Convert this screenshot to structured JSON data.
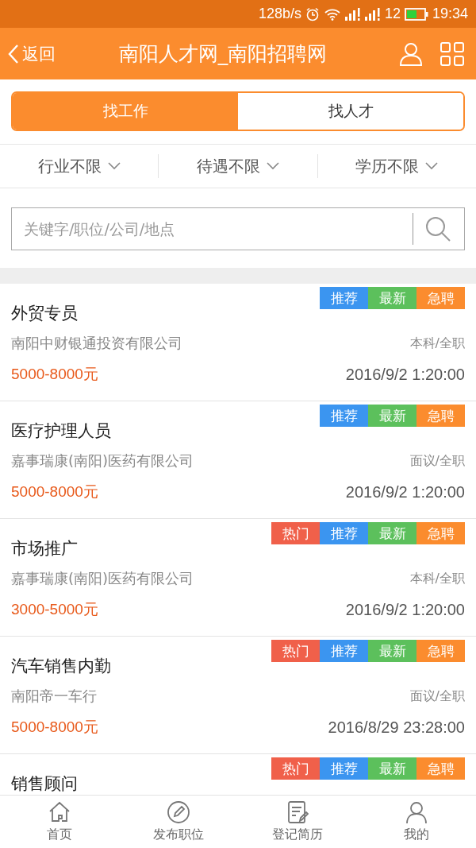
{
  "status_bar": {
    "speed": "128b/s",
    "battery": "12",
    "time": "19:34"
  },
  "header": {
    "back": "返回",
    "title": "南阳人才网_南阳招聘网"
  },
  "tabs": [
    {
      "label": "找工作",
      "selected": true
    },
    {
      "label": "找人才",
      "selected": false
    }
  ],
  "filters": [
    "行业不限",
    "待遇不限",
    "学历不限"
  ],
  "search": {
    "placeholder": "关键字/职位/公司/地点"
  },
  "jobs": [
    {
      "title": "外贸专员",
      "company": "南阳中财银通投资有限公司",
      "requirement": "本科/全职",
      "salary": "5000-8000元",
      "date": "2016/9/2 1:20:00",
      "tags": [
        {
          "kind": "recommend",
          "label": "推荐"
        },
        {
          "kind": "new",
          "label": "最新"
        },
        {
          "kind": "urgent",
          "label": "急聘"
        }
      ]
    },
    {
      "title": "医疗护理人员",
      "company": "嘉事瑞康(南阳)医药有限公司",
      "requirement": "面议/全职",
      "salary": "5000-8000元",
      "date": "2016/9/2 1:20:00",
      "tags": [
        {
          "kind": "recommend",
          "label": "推荐"
        },
        {
          "kind": "new",
          "label": "最新"
        },
        {
          "kind": "urgent",
          "label": "急聘"
        }
      ]
    },
    {
      "title": "市场推广",
      "company": "嘉事瑞康(南阳)医药有限公司",
      "requirement": "本科/全职",
      "salary": "3000-5000元",
      "date": "2016/9/2 1:20:00",
      "tags": [
        {
          "kind": "hot",
          "label": "热门"
        },
        {
          "kind": "recommend",
          "label": "推荐"
        },
        {
          "kind": "new",
          "label": "最新"
        },
        {
          "kind": "urgent",
          "label": "急聘"
        }
      ]
    },
    {
      "title": "汽车销售内勤",
      "company": "南阳帝一车行",
      "requirement": "面议/全职",
      "salary": "5000-8000元",
      "date": "2016/8/29 23:28:00",
      "tags": [
        {
          "kind": "hot",
          "label": "热门"
        },
        {
          "kind": "recommend",
          "label": "推荐"
        },
        {
          "kind": "new",
          "label": "最新"
        },
        {
          "kind": "urgent",
          "label": "急聘"
        }
      ]
    },
    {
      "title": "销售顾问",
      "tags": [
        {
          "kind": "hot",
          "label": "热门"
        },
        {
          "kind": "recommend",
          "label": "推荐"
        },
        {
          "kind": "new",
          "label": "最新"
        },
        {
          "kind": "urgent",
          "label": "急聘"
        }
      ]
    }
  ],
  "bottom_nav": [
    {
      "kind": "home",
      "label": "首页"
    },
    {
      "kind": "post",
      "label": "发布职位"
    },
    {
      "kind": "resume",
      "label": "登记简历"
    },
    {
      "kind": "me",
      "label": "我的"
    }
  ]
}
